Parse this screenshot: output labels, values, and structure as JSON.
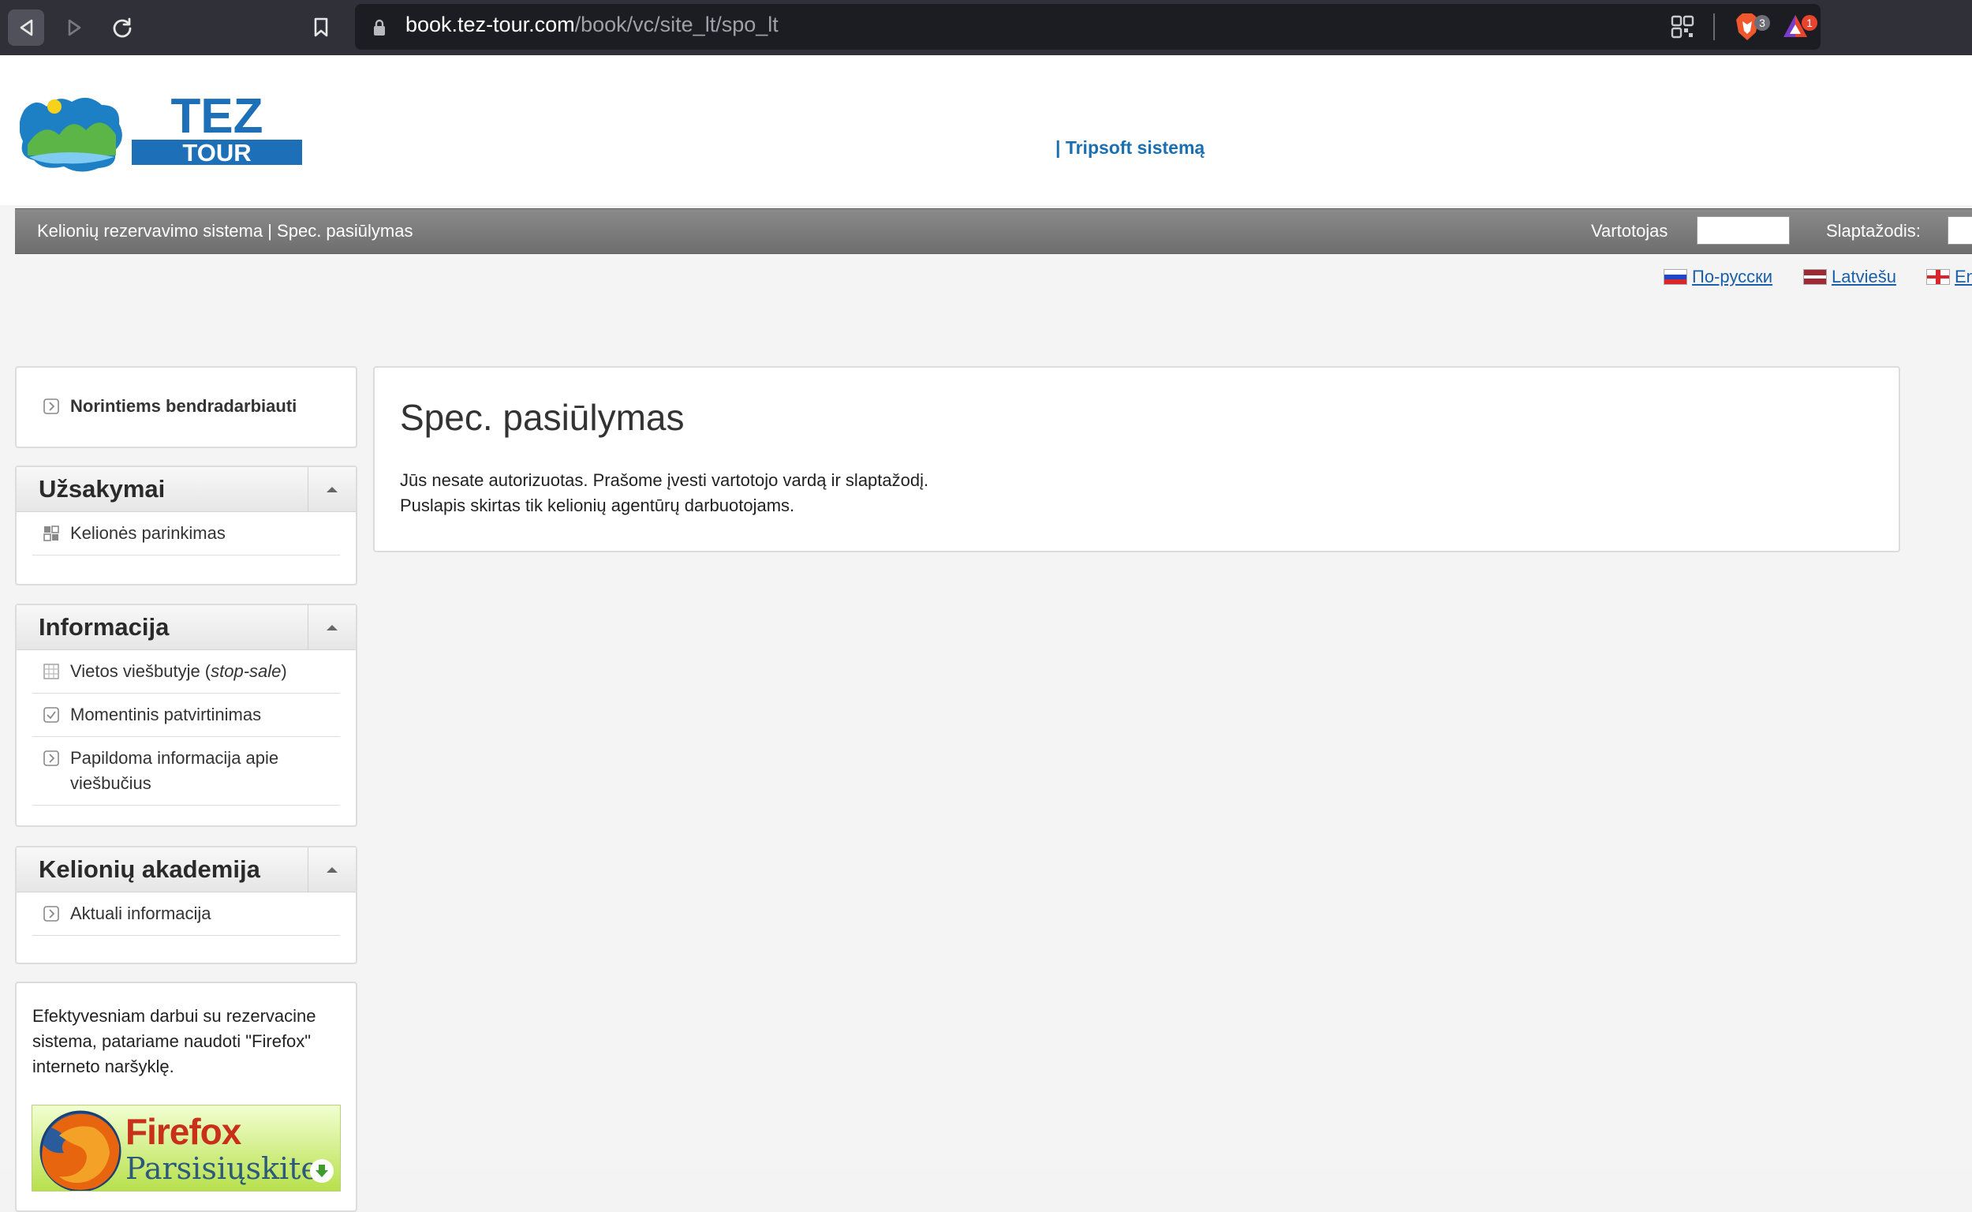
{
  "browser": {
    "url_host": "book.tez-tour.com",
    "url_path": "/book/vc/site_lt/spo_lt",
    "brave_badge": "3",
    "alert_badge": "1"
  },
  "header": {
    "logo_line1": "TEZ",
    "logo_line2": "TOUR",
    "tripsoft_link": "| Tripsoft sistemą"
  },
  "topbar": {
    "breadcrumb": "Kelionių rezervavimo sistema | Spec. pasiūlymas",
    "user_label": "Vartotojas",
    "password_label": "Slaptažodis:"
  },
  "languages": [
    {
      "label": "По-русски"
    },
    {
      "label": "Latviešu"
    },
    {
      "label": "En"
    }
  ],
  "sidebar": {
    "partner_link": "Norintiems bendradarbiauti",
    "orders": {
      "title": "Užsakymai",
      "items": [
        {
          "label": "Kelionės parinkimas"
        }
      ]
    },
    "info": {
      "title": "Informacija",
      "items": [
        {
          "label": "Vietos viešbutyje (",
          "italic": "stop-sale",
          "suffix": ")"
        },
        {
          "label": "Momentinis patvirtinimas"
        },
        {
          "label": "Papildoma informacija apie viešbučius"
        }
      ]
    },
    "academy": {
      "title": "Kelionių akademija",
      "items": [
        {
          "label": "Aktuali informacija"
        }
      ]
    },
    "firefox_note": "Efektyvesniam darbui su rezervacine sistema, patariame naudoti \"Firefox\" interneto naršyklę.",
    "firefox_banner": {
      "line1": "Firefox",
      "line2": "Parsisiųskite"
    }
  },
  "main": {
    "title": "Spec. pasiūlymas",
    "message1": "Jūs nesate autorizuotas. Prašome įvesti vartotojo vardą ir slaptažodį.",
    "message2": "Puslapis skirtas tik kelionių agentūrų darbuotojams."
  },
  "colors": {
    "link": "#1a6fb0",
    "bar": "#7c7c7c",
    "chrome": "#2f3038"
  }
}
